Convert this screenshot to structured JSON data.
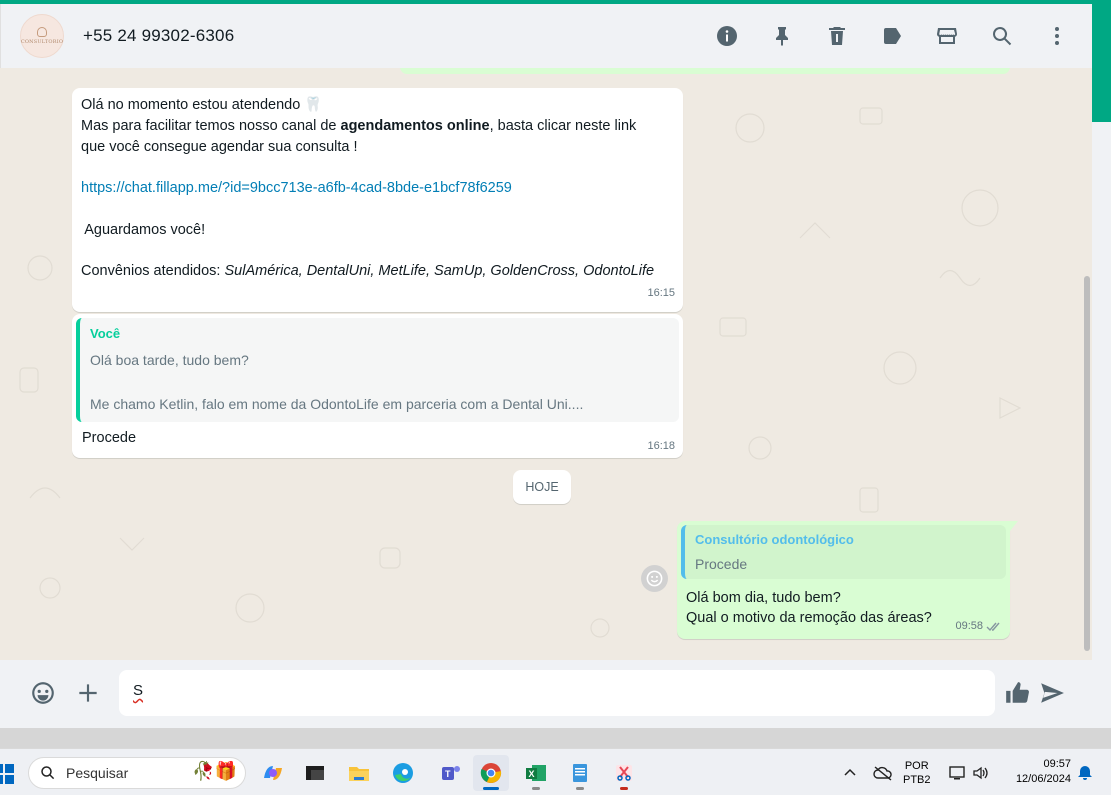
{
  "header": {
    "contact_name": "+55 24 99302-6306",
    "avatar_text": "CONSULTORIO",
    "icons": [
      "info-icon",
      "pin-icon",
      "delete-icon",
      "label-icon",
      "store-icon",
      "search-icon",
      "menu-icon"
    ]
  },
  "messages": {
    "m1": {
      "line1": "Olá no momento estou atendendo 🦷",
      "line2_pre": "Mas para facilitar temos nosso canal de ",
      "line2_bold": "agendamentos online",
      "line2_post": ", basta clicar neste link",
      "line3": "que você consegue agendar sua consulta !",
      "link": "https://chat.fillapp.me/?id=9bcc713e-a6fb-4cad-8bde-e1bcf78f6259",
      "line5": " Aguardamos você!",
      "line6_pre": "Convênios atendidos: ",
      "line6_ital": "SulAmérica, DentalUni, MetLife, SamUp, GoldenCross, OdontoLife",
      "time": "16:15"
    },
    "m2": {
      "quote_author": "Você",
      "quote_line1": "Olá boa tarde, tudo bem?",
      "quote_line2": "Me chamo Ketlin, falo em nome da OdontoLife em parceria com a Dental Uni....",
      "text": "Procede",
      "time": "16:18"
    },
    "date_divider": "HOJE",
    "m3": {
      "quote_author": "Consultório odontológico",
      "quote_text": "Procede",
      "line1": "Olá bom dia, tudo bem?",
      "line2": "Qual o motivo da remoção das áreas?",
      "time": "09:58"
    }
  },
  "composer": {
    "typed_text": "S"
  },
  "taskbar": {
    "search_placeholder": "Pesquisar",
    "lang_line1": "POR",
    "lang_line2": "PTB2",
    "time": "09:57",
    "date": "12/06/2024"
  },
  "colors": {
    "accent": "#00a884",
    "bubble_out": "#d9fdd3",
    "chat_bg": "#efeae2",
    "link": "#027eb5"
  }
}
